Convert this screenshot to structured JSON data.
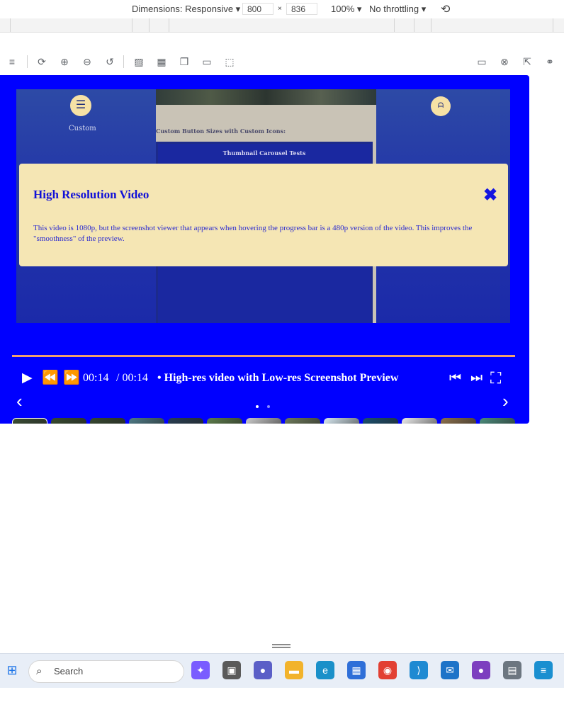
{
  "devtools": {
    "dimensions_label": "Dimensions: Responsive ▾",
    "width_value": "800",
    "times": "×",
    "height_value": "836",
    "zoom_label": "100% ▾",
    "throttle_label": "No throttling ▾"
  },
  "video": {
    "left_button_label": "Custom",
    "right_button_label": "ᗩ",
    "center_caption": "Custom Button Sizes with Custom Icons:",
    "inner_title": "Thumbnail Carousel Tests"
  },
  "info_panel": {
    "title": "High Resolution Video",
    "body": "This video is 1080p, but the screenshot viewer that appears when hovering the progress bar is a 480p version of the video. This improves the \"smoothness\" of the preview.",
    "close_glyph": "✖"
  },
  "controls": {
    "current_time": "00:14",
    "duration": "/ 00:14",
    "title": "• High-res video with Low-res Screenshot Preview",
    "progress_fraction": 1.0
  },
  "carousel": {
    "thumbnails": [
      {
        "name": "thumb-1",
        "bg": "#3a4d34",
        "active": true
      },
      {
        "name": "thumb-2",
        "bg": "#384a30",
        "active": false
      },
      {
        "name": "thumb-3",
        "bg": "#36472f",
        "active": false
      },
      {
        "name": "thumb-4",
        "bg": "#4e7a86",
        "active": false
      },
      {
        "name": "thumb-5",
        "bg": "#283e52",
        "active": false
      },
      {
        "name": "thumb-6",
        "bg": "#5d7d4b",
        "active": false
      },
      {
        "name": "thumb-7",
        "bg": "#c9c9c9",
        "active": false
      },
      {
        "name": "thumb-8",
        "bg": "#6e7a5a",
        "active": false
      },
      {
        "name": "thumb-9",
        "bg": "#d7e8f0",
        "active": false
      },
      {
        "name": "thumb-10",
        "bg": "#1b4f6e",
        "active": false
      },
      {
        "name": "thumb-11",
        "bg": "#eaeaea",
        "active": false
      },
      {
        "name": "thumb-12",
        "bg": "#8b6f4c",
        "active": false
      },
      {
        "name": "thumb-13",
        "bg": "#4b8a7a",
        "active": false
      }
    ],
    "prev_glyph": "‹",
    "next_glyph": "›",
    "dots": [
      {
        "active": true
      },
      {
        "active": false
      }
    ]
  },
  "taskbar": {
    "search_placeholder": "Search",
    "apps": [
      {
        "name": "copilot-icon",
        "bg": "#7a5cff",
        "glyph": "✦"
      },
      {
        "name": "obs-icon",
        "bg": "#5a5a5a",
        "glyph": "▣"
      },
      {
        "name": "teams-icon",
        "bg": "#5b5fc7",
        "glyph": "●"
      },
      {
        "name": "file-explorer-icon",
        "bg": "#f2b32c",
        "glyph": "▬"
      },
      {
        "name": "edge-icon",
        "bg": "#1a90c9",
        "glyph": "e"
      },
      {
        "name": "store-icon",
        "bg": "#2f6fd8",
        "glyph": "▦"
      },
      {
        "name": "chrome-icon",
        "bg": "#e24033",
        "glyph": "◉"
      },
      {
        "name": "vscode-icon",
        "bg": "#1f8ad2",
        "glyph": "⟩"
      },
      {
        "name": "mail-icon",
        "bg": "#1d73c8",
        "glyph": "✉"
      },
      {
        "name": "github-icon",
        "bg": "#7d3fbf",
        "glyph": "●"
      },
      {
        "name": "calculator-icon",
        "bg": "#6c7680",
        "glyph": "▤"
      },
      {
        "name": "notepad-icon",
        "bg": "#1a8fd0",
        "glyph": "≡"
      }
    ]
  },
  "colors": {
    "player_bg": "#0000ff",
    "info_bg": "#f5e6b4",
    "info_text": "#1010d8",
    "progress": "#f0a070"
  }
}
